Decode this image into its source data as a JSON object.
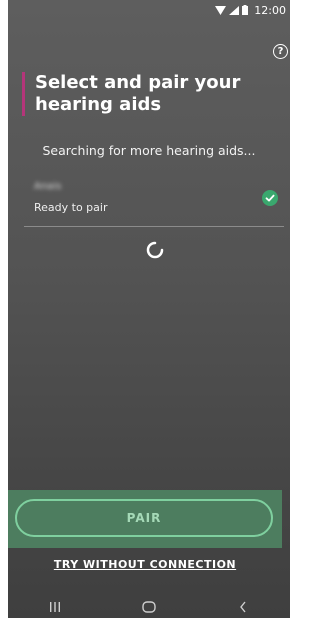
{
  "status_bar": {
    "time": "12:00",
    "icons": [
      "wifi-icon",
      "signal-icon",
      "battery-icon"
    ]
  },
  "help": {
    "label": "?"
  },
  "header": {
    "title": "Select and pair your hearing aids"
  },
  "search": {
    "status_text": "Searching for more hearing aids..."
  },
  "device": {
    "name": "Anais",
    "status": "Ready to pair",
    "selected": true
  },
  "actions": {
    "pair_label": "PAIR",
    "try_label": "TRY WITHOUT CONNECTION"
  },
  "navbar": {
    "items": [
      "recents-icon",
      "home-icon",
      "back-icon"
    ]
  },
  "colors": {
    "accent": "#b5357a",
    "success": "#3aa86e",
    "pair_bar": "#4d7d5f",
    "pair_border": "#7fd09f"
  }
}
